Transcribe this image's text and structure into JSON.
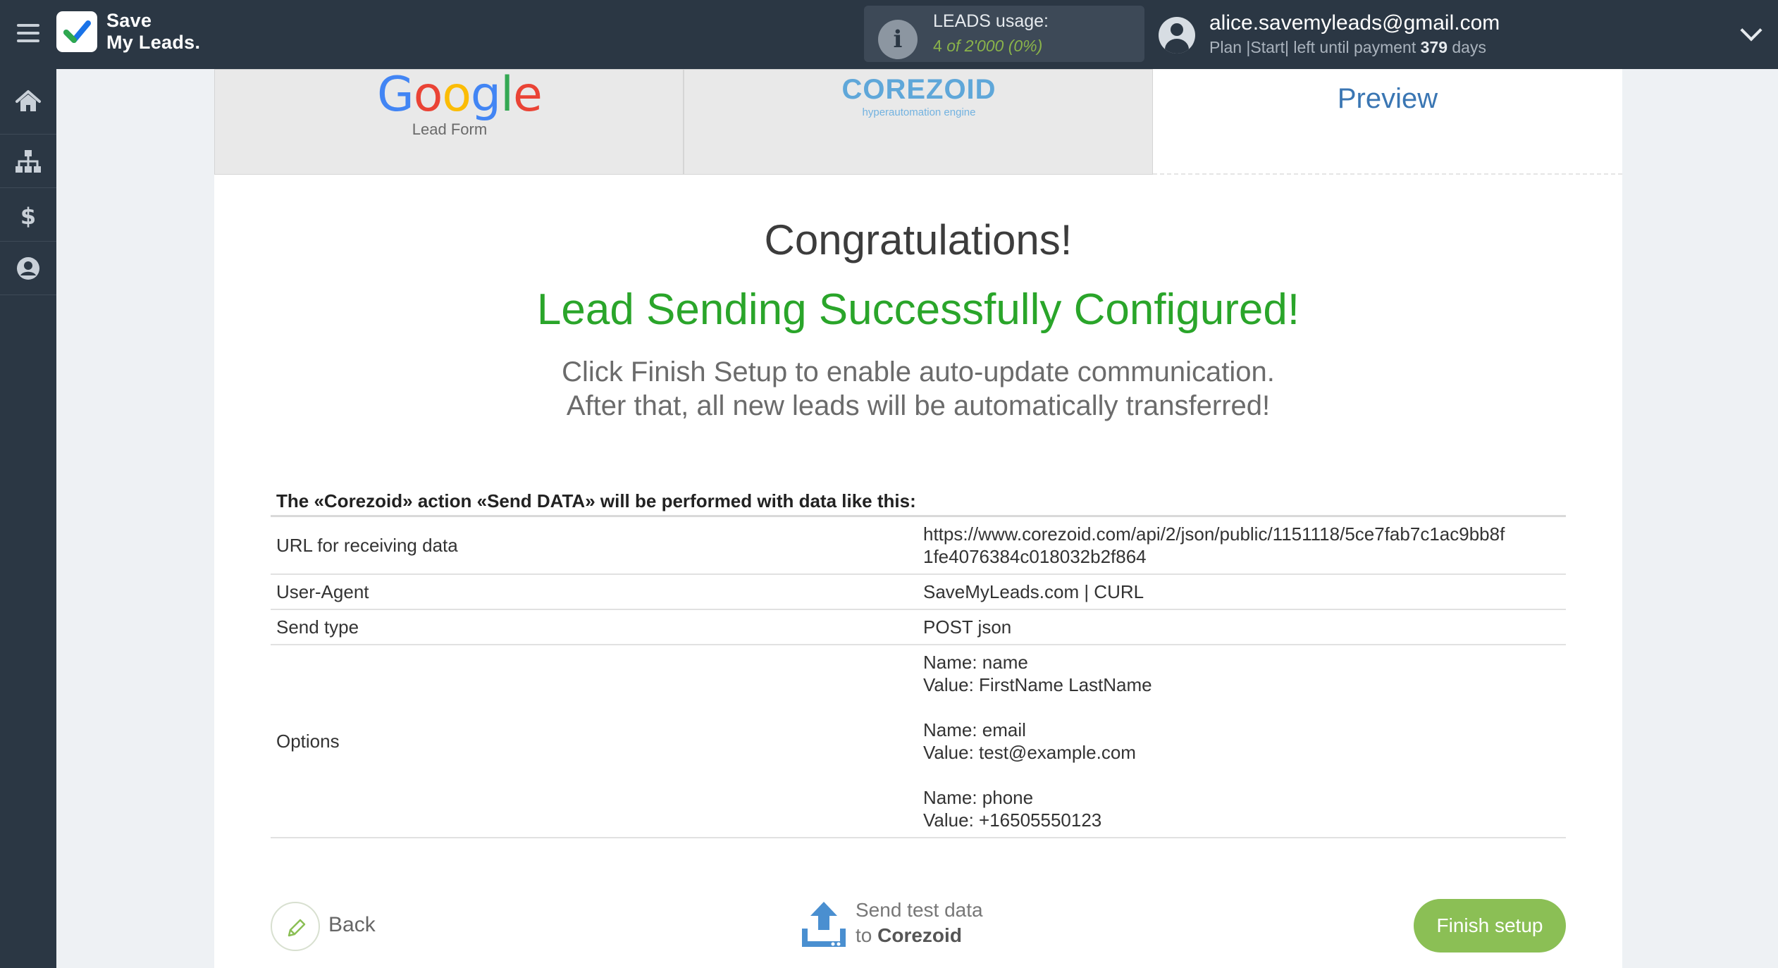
{
  "app": {
    "logo_line1": "Save",
    "logo_line2": "My Leads."
  },
  "usage": {
    "title": "LEADS usage:",
    "used": "4",
    "of_label": "of",
    "total": "2'000",
    "percent": "(0%)",
    "icon": "info-icon"
  },
  "user": {
    "email": "alice.savemyleads@gmail.com",
    "plan_prefix": "Plan |Start| left until payment",
    "days_left": "379",
    "days_suffix": "days"
  },
  "sidebar": {
    "items": [
      {
        "icon": "home-icon"
      },
      {
        "icon": "sitemap-icon"
      },
      {
        "icon": "dollar-icon"
      },
      {
        "icon": "user-circle-icon"
      }
    ]
  },
  "tabs": {
    "google": {
      "name": "Google",
      "sub": "Lead Form"
    },
    "corezoid": {
      "name": "COREZOID",
      "sub": "hyperautomation engine"
    },
    "preview": {
      "label": "Preview"
    }
  },
  "content": {
    "congrats": "Congratulations!",
    "success": "Lead Sending Successfully Configured!",
    "instr_line1": "Click Finish Setup to enable auto-update communication.",
    "instr_line2": "After that, all new leads will be automatically transferred!"
  },
  "table": {
    "heading": "The «Corezoid» action «Send DATA» will be performed with data like this:",
    "rows": [
      {
        "key": "URL for receiving data",
        "value_line1": "https://www.corezoid.com/api/2/json/public/1151118/5ce7fab7c1ac9bb8f",
        "value_line2": "1fe4076384c018032b2f864"
      },
      {
        "key": "User-Agent",
        "value": "SaveMyLeads.com | CURL"
      },
      {
        "key": "Send type",
        "value": "POST json"
      },
      {
        "key": "Options",
        "options": [
          {
            "name": "Name: name",
            "value": "Value: FirstName LastName"
          },
          {
            "name": "Name: email",
            "value": "Value: test@example.com"
          },
          {
            "name": "Name: phone",
            "value": "Value: +16505550123"
          }
        ]
      }
    ]
  },
  "footer": {
    "back": "Back",
    "send_line1": "Send test data",
    "send_line2_prefix": "to",
    "send_line2_name": "Corezoid",
    "finish": "Finish setup"
  },
  "colors": {
    "topbar": "#2b3744",
    "success_green": "#2aa52a",
    "finish_button": "#8bbf55",
    "preview_blue": "#3a76b3"
  }
}
